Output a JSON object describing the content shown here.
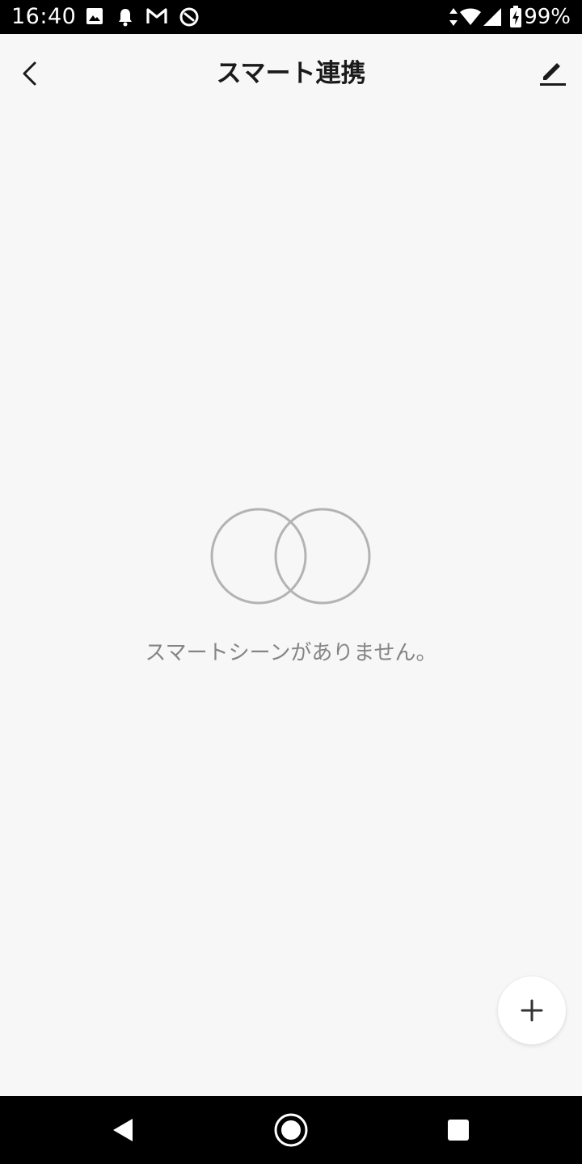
{
  "status_bar": {
    "time": "16:40",
    "battery_percent": "99%",
    "icons": [
      "image-icon",
      "notification-bell-icon",
      "gmail-icon",
      "sync-blocked-icon",
      "data-arrows-icon",
      "wifi-icon",
      "signal-icon",
      "battery-charging-icon"
    ]
  },
  "header": {
    "title": "スマート連携",
    "back_icon": "chevron-left-icon",
    "edit_icon": "pencil-icon"
  },
  "empty_state": {
    "message": "スマートシーンがありません。",
    "illustration": "overlapping-circles-icon"
  },
  "fab": {
    "icon": "plus-icon"
  },
  "nav_bar": {
    "buttons": [
      "back-triangle-icon",
      "home-circle-icon",
      "recents-square-icon"
    ]
  },
  "colors": {
    "background": "#f7f7f7",
    "title_text": "#1a1a1a",
    "muted_text": "#858585",
    "illustration_stroke": "#b3b3b3"
  }
}
